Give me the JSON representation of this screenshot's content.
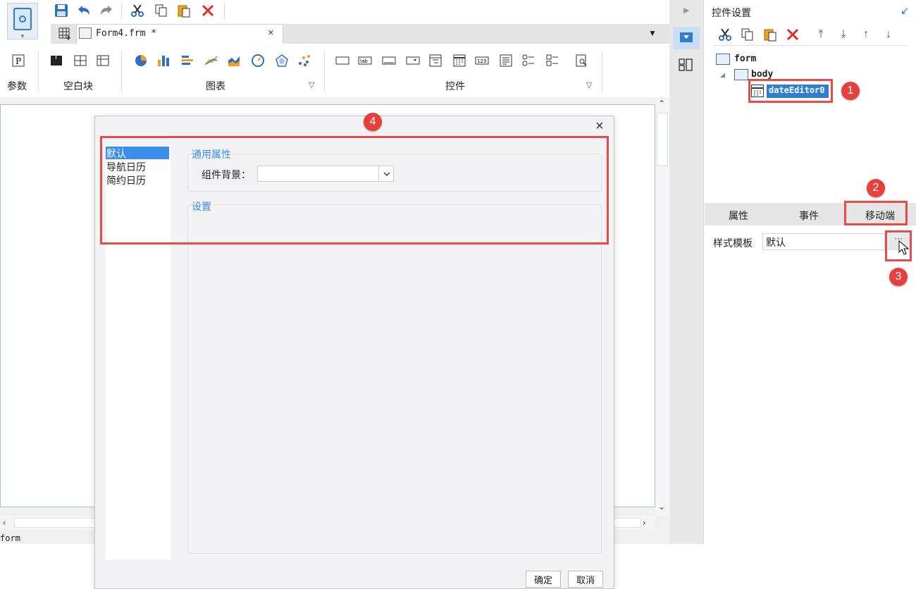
{
  "editor": {
    "tab_label": "Form4.frm *",
    "tab_close": "×"
  },
  "ribbon": {
    "groups": [
      {
        "label": "参数"
      },
      {
        "label": "空白块"
      },
      {
        "label": "图表"
      },
      {
        "label": "控件"
      }
    ]
  },
  "status": {
    "text": "form"
  },
  "panel": {
    "title": "控件设置",
    "tree": {
      "root": "form",
      "body": "body",
      "selected": "dateEditor0"
    },
    "tabs": [
      "属性",
      "事件",
      "移动端"
    ],
    "style_template": {
      "label": "样式模板",
      "value": "默认",
      "button": "···"
    }
  },
  "badges": [
    "1",
    "2",
    "3",
    "4"
  ],
  "dialog": {
    "close": "×",
    "list": [
      "默认",
      "导航日历",
      "简约日历"
    ],
    "general_title": "通用属性",
    "bg_label": "组件背景：",
    "settings_title": "设置",
    "ok": "确定",
    "cancel": "取消"
  },
  "colors": {
    "accent": "#3b8eea",
    "highlight": "#e84a4a",
    "selection": "#2f7fd0"
  }
}
